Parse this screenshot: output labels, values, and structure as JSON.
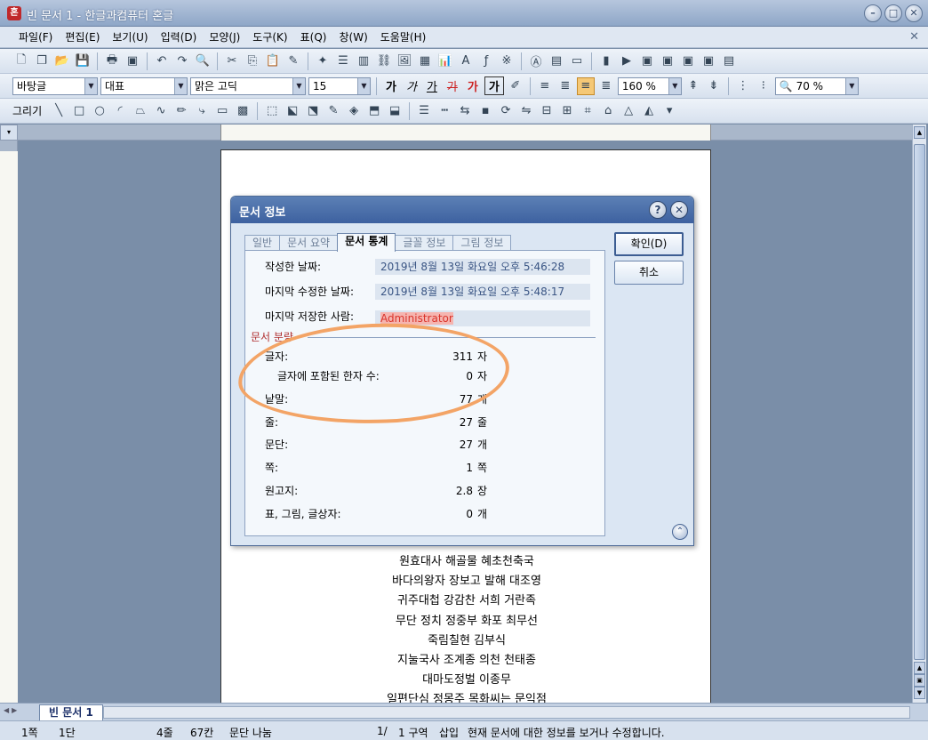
{
  "window": {
    "title": "빈 문서 1 - 한글과컴퓨터 혼글",
    "app_icon": "혼"
  },
  "menu": [
    "파일(F)",
    "편집(E)",
    "보기(U)",
    "입력(D)",
    "모양(J)",
    "도구(K)",
    "표(Q)",
    "창(W)",
    "도움말(H)"
  ],
  "formatting": {
    "style": "바탕글",
    "font_lang": "대표",
    "font": "맑은 고딕",
    "size": "15",
    "char_spacing": "160 %",
    "zoom": "70 %",
    "bold": "가",
    "italic": "가",
    "underline": "가",
    "strike": "가",
    "color": "가",
    "shade": "가"
  },
  "draw_toolbar": {
    "label": "그리기"
  },
  "document_lines": [
    "원효대사 해골물 혜초천축국",
    "바다의왕자 장보고 발해 대조영",
    "귀주대첩 강감찬 서희 거란족",
    "무단 정치 정중부 화포 최무선",
    "죽림칠현 김부식",
    "지눌국사 조계종 의천 천태종",
    "대마도정벌 이종무",
    "일편단심 정몽주 목화씨는 문익점"
  ],
  "dialog": {
    "title": "문서 정보",
    "tabs": [
      "일반",
      "문서 요약",
      "문서 통계",
      "글꼴 정보",
      "그림 정보"
    ],
    "active_tab": 2,
    "fields": [
      {
        "label": "작성한 날짜:",
        "value": "2019년 8월 13일 화요일 오후 5:46:28"
      },
      {
        "label": "마지막 수정한 날짜:",
        "value": "2019년 8월 13일 화요일 오후 5:48:17"
      },
      {
        "label": "마지막 저장한 사람:",
        "value": "Administrator"
      }
    ],
    "group_label": "문서 분량",
    "stats": [
      {
        "label": "글자:",
        "value": "311",
        "unit": "자"
      },
      {
        "label": "글자에 포함된 한자 수:",
        "value": "0",
        "unit": "자"
      },
      {
        "label": "낱말:",
        "value": "77",
        "unit": "개"
      },
      {
        "label": "줄:",
        "value": "27",
        "unit": "줄"
      },
      {
        "label": "문단:",
        "value": "27",
        "unit": "개"
      },
      {
        "label": "쪽:",
        "value": "1",
        "unit": "쪽"
      },
      {
        "label": "원고지:",
        "value": "2.8",
        "unit": "장"
      },
      {
        "label": "표, 그림, 글상자:",
        "value": "0",
        "unit": "개"
      }
    ],
    "ok_label": "확인(D)",
    "cancel_label": "취소"
  },
  "tabbar": {
    "doc_tab": "빈 문서 1"
  },
  "status": {
    "page": "1쪽",
    "column": "1단",
    "line": "4줄",
    "col": "67칸",
    "break": "문단 나눔",
    "page_count": "1/",
    "section": "1 구역",
    "mode": "삽입",
    "message": "현재 문서에 대한 정보를 보거나 수정합니다."
  },
  "colors": {
    "highlight": "#f3a466",
    "title_bar": "#3d61a0"
  }
}
